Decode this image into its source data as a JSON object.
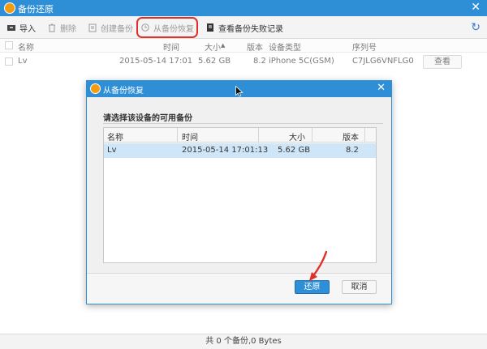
{
  "window": {
    "title": "备份还原",
    "close_glyph": "✕",
    "refresh_glyph": "↻"
  },
  "toolbar": {
    "import": "导入",
    "delete": "删除",
    "create_backup": "创建备份",
    "restore_from_backup": "从备份恢复",
    "view_failed": "查看备份失败记录"
  },
  "table": {
    "headers": {
      "name": "名称",
      "time": "时间",
      "size": "大小",
      "version": "版本",
      "device_type": "设备类型",
      "serial": "序列号"
    },
    "rows": [
      {
        "name": "Lv",
        "time": "2015-05-14 17:01",
        "size": "5.62 GB",
        "version": "8.2",
        "device_type": "iPhone 5C(GSM)",
        "serial": "C7JLG6VNFLG0",
        "action": "查看"
      }
    ]
  },
  "status": {
    "text": "共 0 个备份,0 Bytes"
  },
  "dialog": {
    "title": "从备份恢复",
    "close_glyph": "✕",
    "prompt": "请选择该设备的可用备份",
    "headers": {
      "name": "名称",
      "time": "时间",
      "size": "大小",
      "version": "版本"
    },
    "rows": [
      {
        "name": "Lv",
        "time": "2015-05-14 17:01:13",
        "size": "5.62 GB",
        "version": "8.2"
      }
    ],
    "restore_button": "还原",
    "cancel_button": "取消"
  },
  "colors": {
    "accent": "#2f8fd6",
    "highlight": "#e1302a",
    "selected_row": "#cfe6f8"
  }
}
